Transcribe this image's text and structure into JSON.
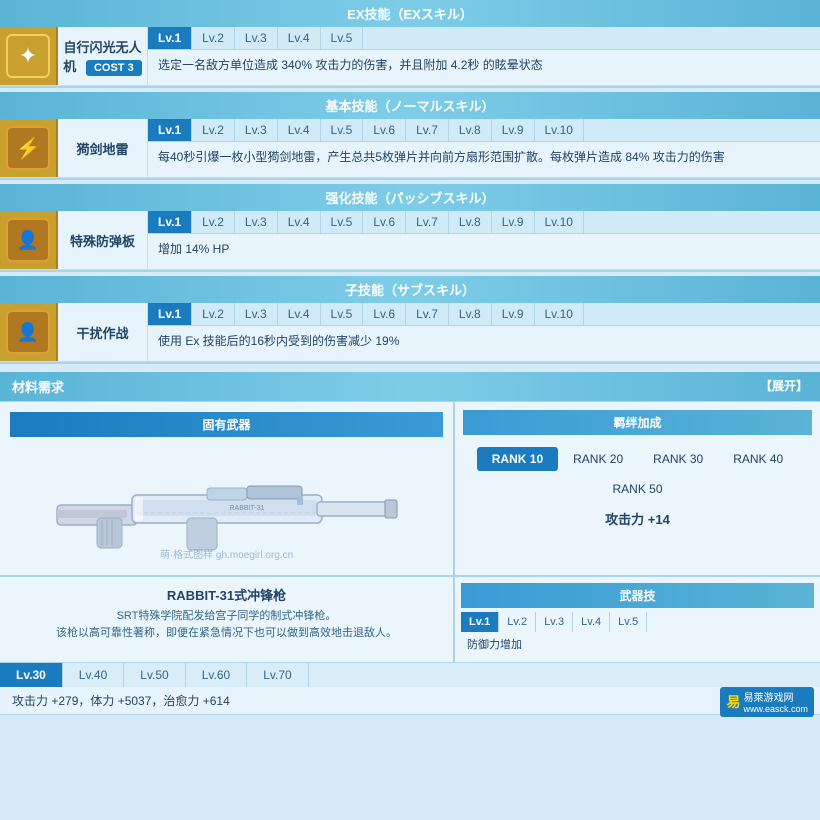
{
  "ex_skill": {
    "header": "EX技能（EXスキル）",
    "icon_symbol": "✦",
    "name": "自行闪光无人机",
    "cost_label": "COST",
    "cost_value": "3",
    "levels": [
      "Lv.1",
      "Lv.2",
      "Lv.3",
      "Lv.4",
      "Lv.5"
    ],
    "active_level": 0,
    "desc": "选定一名敌方单位造成 340% 攻击力的伤害，并且附加 4.2秒 的眩晕状态"
  },
  "basic_skill": {
    "header": "基本技能（ノーマルスキル）",
    "icon_symbol": "⚡",
    "name": "㺃剑地雷",
    "levels": [
      "Lv.1",
      "Lv.2",
      "Lv.3",
      "Lv.4",
      "Lv.5",
      "Lv.6",
      "Lv.7",
      "Lv.8",
      "Lv.9",
      "Lv.10"
    ],
    "active_level": 0,
    "desc": "每40秒引爆一枚小型㺃剑地雷，产生总共5枚弹片并向前方扇形范围扩散。每枚弹片造成 84% 攻击力的伤害"
  },
  "enhance_skill": {
    "header": "强化技能（パッシブスキル）",
    "icon_symbol": "👤",
    "name": "特殊防弹板",
    "levels": [
      "Lv.1",
      "Lv.2",
      "Lv.3",
      "Lv.4",
      "Lv.5",
      "Lv.6",
      "Lv.7",
      "Lv.8",
      "Lv.9",
      "Lv.10"
    ],
    "active_level": 0,
    "desc": "增加 14% HP"
  },
  "sub_skill": {
    "header": "子技能（サブスキル）",
    "icon_symbol": "👤",
    "name": "干扰作战",
    "levels": [
      "Lv.1",
      "Lv.2",
      "Lv.3",
      "Lv.4",
      "Lv.5",
      "Lv.6",
      "Lv.7",
      "Lv.8",
      "Lv.9",
      "Lv.10"
    ],
    "active_level": 0,
    "desc": "使用 Ex 技能后的16秒内受到的伤害减少 19%"
  },
  "materials": {
    "header": "材料需求",
    "expand_label": "【展开】",
    "weapon_header": "固有武器",
    "bonus_header": "羁绊加成",
    "weapon_name": "RABBIT-31式冲锋枪",
    "weapon_desc1": "SRT特殊学院配发给宫子同学的制式冲锋枪。",
    "weapon_desc2": "该枪以高可靠性著称，即便在紧急情况下也可以做到高效地击退敌人。",
    "rank_tabs": [
      "RANK 10",
      "RANK 20",
      "RANK 30",
      "RANK 40",
      "RANK 50"
    ],
    "active_rank": 0,
    "bonus_desc": "攻击力 +14",
    "weapon_levels": [
      "Lv.30",
      "Lv.40",
      "Lv.50",
      "Lv.60",
      "Lv.70"
    ],
    "active_weapon_level": 0,
    "weapon_stats": "攻击力 +279，体力 +5037，治愈力 +614",
    "watermark": "萌·格式图样  gh.moegirl.org.cn",
    "weapon_tech_header": "武器技",
    "weapon_tech_levels": [
      "Lv.1",
      "Lv.2",
      "Lv.3",
      "Lv.4",
      "Lv.5"
    ],
    "weapon_tech_active": 0,
    "weapon_tech_label": "防御力增加",
    "site_logo": "易萊游戏网",
    "site_url": "www.easck.com"
  }
}
